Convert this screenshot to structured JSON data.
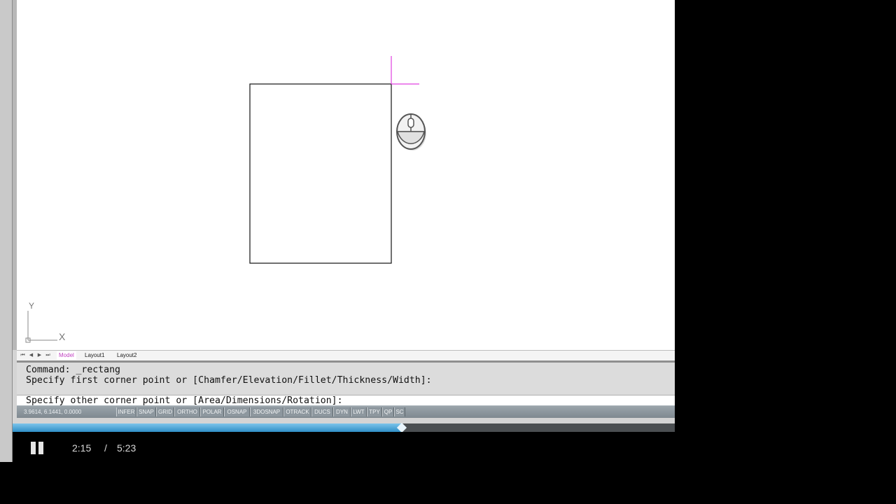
{
  "drawing": {
    "ucs_x_label": "X",
    "ucs_y_label": "Y"
  },
  "layout_tabs": [
    {
      "label": "Model",
      "active": true
    },
    {
      "label": "Layout1",
      "active": false
    },
    {
      "label": "Layout2",
      "active": false
    }
  ],
  "command_window": {
    "history": [
      "Command: _rectang",
      "Specify first corner point or [Chamfer/Elevation/Fillet/Thickness/Width]:"
    ],
    "prompt": "Specify other corner point or [Area/Dimensions/Rotation]:"
  },
  "status_bar": {
    "coordinates": "3.9614, 6.1441, 0.0000",
    "toggles": [
      "INFER",
      "SNAP",
      "GRID",
      "ORTHO",
      "POLAR",
      "OSNAP",
      "3DOSNAP",
      "OTRACK",
      "DUCS",
      "DYN",
      "LWT",
      "TPY",
      "QP",
      "SC"
    ]
  },
  "player": {
    "progress_fraction": 0.588,
    "current_time": "2:15",
    "separator": "/",
    "total_time": "5:23"
  },
  "colors": {
    "crosshair": "#e040e0",
    "active_tab": "#c040c0",
    "progress": "#3a9ad4"
  },
  "icons": {
    "mouse": "mouse-left-click-icon",
    "pause": "pause-icon"
  }
}
